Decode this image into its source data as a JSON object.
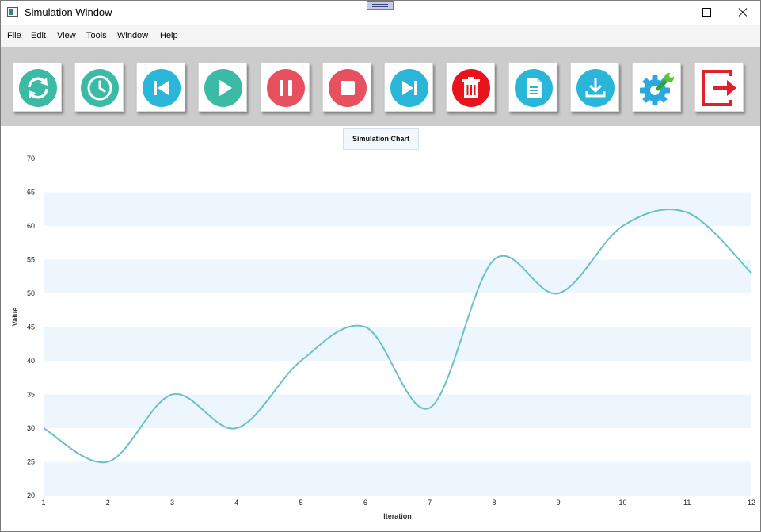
{
  "window": {
    "title": "Simulation Window"
  },
  "menu": [
    "File",
    "Edit",
    "View",
    "Tools",
    "Window",
    "Help"
  ],
  "toolbar": {
    "buttons": [
      {
        "name": "refresh-button",
        "icon": "refresh-icon",
        "color": "#3bbba5"
      },
      {
        "name": "history-button",
        "icon": "clock-icon",
        "color": "#3bbba5"
      },
      {
        "name": "skip-back-button",
        "icon": "skip-back-icon",
        "color": "#29b6d8"
      },
      {
        "name": "play-button",
        "icon": "play-icon",
        "color": "#3bbba5"
      },
      {
        "name": "pause-button",
        "icon": "pause-icon",
        "color": "#e6505f"
      },
      {
        "name": "stop-button",
        "icon": "stop-icon",
        "color": "#e6505f"
      },
      {
        "name": "skip-forward-button",
        "icon": "skip-forward-icon",
        "color": "#29b6d8"
      },
      {
        "name": "delete-button",
        "icon": "trash-icon",
        "color": "#e8141c"
      },
      {
        "name": "document-button",
        "icon": "document-icon",
        "color": "#29b6d8"
      },
      {
        "name": "download-button",
        "icon": "download-icon",
        "color": "#29b6d8"
      },
      {
        "name": "settings-button",
        "icon": "gear-wrench-icon",
        "color": "#2aa8e0"
      },
      {
        "name": "exit-button",
        "icon": "exit-icon",
        "color": "#e0202a"
      }
    ]
  },
  "chart_data": {
    "type": "line",
    "title": "Simulation Chart",
    "xlabel": "Iteration",
    "ylabel": "Value",
    "x": [
      1,
      2,
      3,
      4,
      5,
      6,
      7,
      8,
      9,
      10,
      11,
      12
    ],
    "series": [
      {
        "values": [
          30,
          25,
          35,
          30,
          40,
          45,
          33,
          55,
          50,
          60,
          62,
          53
        ],
        "color": "#6bbfcf"
      }
    ],
    "xticks": [
      "1",
      "2",
      "3",
      "4",
      "5",
      "6",
      "7",
      "8",
      "9",
      "10",
      "11",
      "12"
    ],
    "yticks": [
      "20",
      "25",
      "30",
      "35",
      "40",
      "45",
      "50",
      "55",
      "60",
      "65",
      "70"
    ],
    "xlim": [
      1,
      12
    ],
    "ylim": [
      20,
      70
    ],
    "grid": "alternating horizontal bands",
    "band_color": "#eef6fd"
  }
}
